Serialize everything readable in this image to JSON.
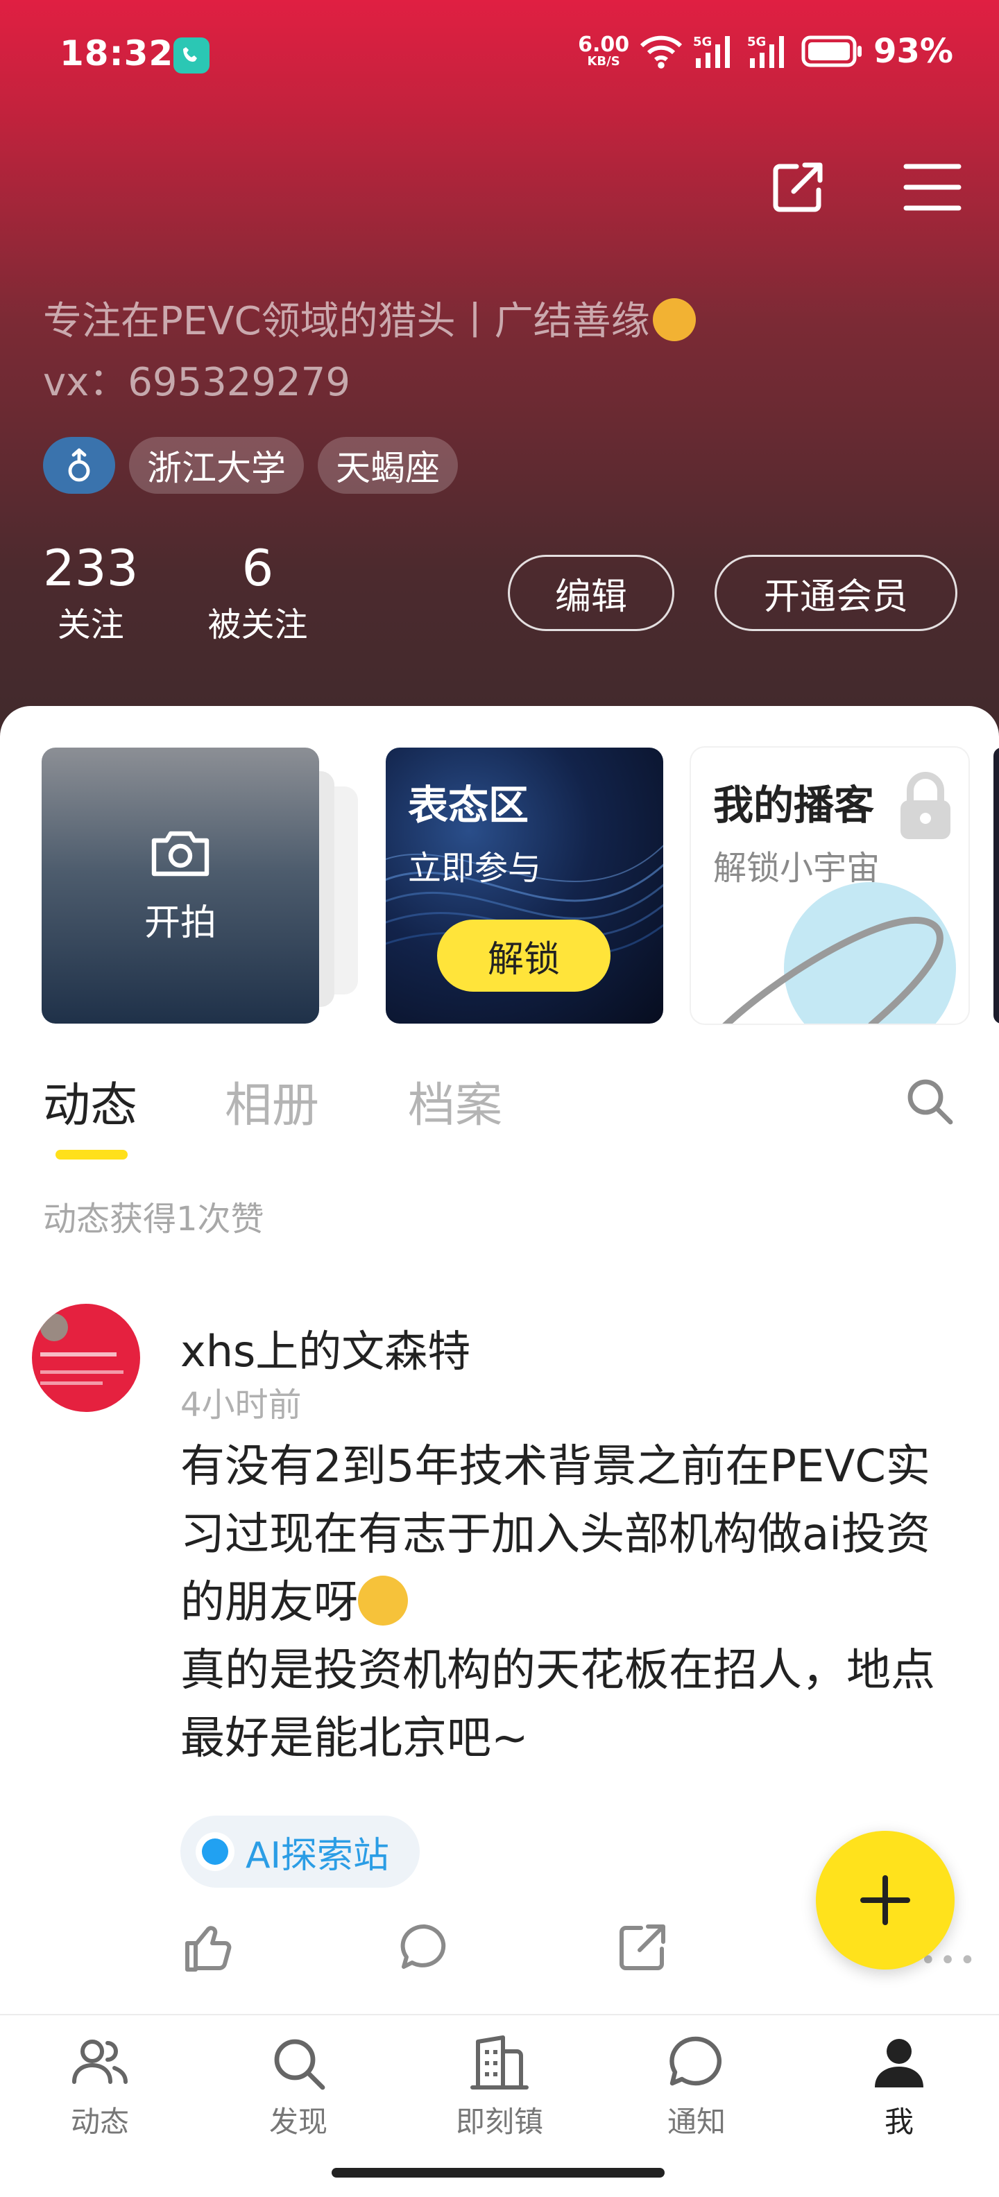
{
  "status_bar": {
    "time": "18:32",
    "net_speed_value": "6.00",
    "net_speed_unit": "KB/S",
    "battery": "93%"
  },
  "profile": {
    "bio_line1": "专注在PEVC领域的猎头丨广结善缘",
    "bio_line2": "vx：695329279",
    "tags": [
      "浙江大学",
      "天蝎座"
    ],
    "following_count": "233",
    "following_label": "关注",
    "followers_count": "6",
    "followers_label": "被关注",
    "edit_label": "编辑",
    "vip_label": "开通会员"
  },
  "cards": {
    "camera_label": "开拍",
    "vote_title": "表态区",
    "vote_sub": "立即参与",
    "vote_button": "解锁",
    "podcast_title": "我的播客",
    "podcast_sub": "解锁小宇宙"
  },
  "tabs": [
    "动态",
    "相册",
    "档案"
  ],
  "likes_summary": "动态获得1次赞",
  "post": {
    "author": "xhs上的文森特",
    "time": "4小时前",
    "body_part1": "有没有2到5年技术背景之前在PEVC实习过现在有志于加入头部机构做ai投资的朋友呀",
    "body_part2": "真的是投资机构的天花板在招人，地点最好是能北京吧~",
    "topic": "AI探索站"
  },
  "bottom_nav": [
    "动态",
    "发现",
    "即刻镇",
    "通知",
    "我"
  ],
  "colors": {
    "header_top": "#e01f42",
    "header_bottom": "#3f2a2c",
    "accent_yellow": "#ffe21c",
    "topic_blue": "#2b9de5"
  }
}
